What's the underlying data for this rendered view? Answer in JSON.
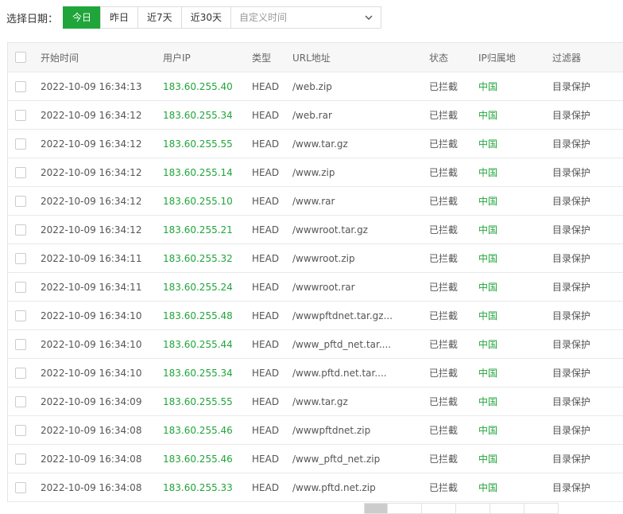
{
  "filter": {
    "label": "选择日期：",
    "ranges": [
      "今日",
      "昨日",
      "近7天",
      "近30天"
    ],
    "active_index": 0,
    "custom_placeholder": "自定义时间"
  },
  "table": {
    "headers": [
      "开始时间",
      "用户IP",
      "类型",
      "URL地址",
      "状态",
      "IP归属地",
      "过滤器"
    ],
    "rows": [
      {
        "time": "2022-10-09 16:34:13",
        "ip": "183.60.255.40",
        "type": "HEAD",
        "url": "/web.zip",
        "status": "已拦截",
        "loc": "中国",
        "filter": "目录保护"
      },
      {
        "time": "2022-10-09 16:34:12",
        "ip": "183.60.255.34",
        "type": "HEAD",
        "url": "/web.rar",
        "status": "已拦截",
        "loc": "中国",
        "filter": "目录保护"
      },
      {
        "time": "2022-10-09 16:34:12",
        "ip": "183.60.255.55",
        "type": "HEAD",
        "url": "/www.tar.gz",
        "status": "已拦截",
        "loc": "中国",
        "filter": "目录保护"
      },
      {
        "time": "2022-10-09 16:34:12",
        "ip": "183.60.255.14",
        "type": "HEAD",
        "url": "/www.zip",
        "status": "已拦截",
        "loc": "中国",
        "filter": "目录保护"
      },
      {
        "time": "2022-10-09 16:34:12",
        "ip": "183.60.255.10",
        "type": "HEAD",
        "url": "/www.rar",
        "status": "已拦截",
        "loc": "中国",
        "filter": "目录保护"
      },
      {
        "time": "2022-10-09 16:34:12",
        "ip": "183.60.255.21",
        "type": "HEAD",
        "url": "/wwwroot.tar.gz",
        "status": "已拦截",
        "loc": "中国",
        "filter": "目录保护"
      },
      {
        "time": "2022-10-09 16:34:11",
        "ip": "183.60.255.32",
        "type": "HEAD",
        "url": "/wwwroot.zip",
        "status": "已拦截",
        "loc": "中国",
        "filter": "目录保护"
      },
      {
        "time": "2022-10-09 16:34:11",
        "ip": "183.60.255.24",
        "type": "HEAD",
        "url": "/wwwroot.rar",
        "status": "已拦截",
        "loc": "中国",
        "filter": "目录保护"
      },
      {
        "time": "2022-10-09 16:34:10",
        "ip": "183.60.255.48",
        "type": "HEAD",
        "url": "/wwwpftdnet.tar.gz...",
        "status": "已拦截",
        "loc": "中国",
        "filter": "目录保护"
      },
      {
        "time": "2022-10-09 16:34:10",
        "ip": "183.60.255.44",
        "type": "HEAD",
        "url": "/www_pftd_net.tar....",
        "status": "已拦截",
        "loc": "中国",
        "filter": "目录保护"
      },
      {
        "time": "2022-10-09 16:34:10",
        "ip": "183.60.255.34",
        "type": "HEAD",
        "url": "/www.pftd.net.tar....",
        "status": "已拦截",
        "loc": "中国",
        "filter": "目录保护"
      },
      {
        "time": "2022-10-09 16:34:09",
        "ip": "183.60.255.55",
        "type": "HEAD",
        "url": "/www.tar.gz",
        "status": "已拦截",
        "loc": "中国",
        "filter": "目录保护"
      },
      {
        "time": "2022-10-09 16:34:08",
        "ip": "183.60.255.46",
        "type": "HEAD",
        "url": "/wwwpftdnet.zip",
        "status": "已拦截",
        "loc": "中国",
        "filter": "目录保护"
      },
      {
        "time": "2022-10-09 16:34:08",
        "ip": "183.60.255.46",
        "type": "HEAD",
        "url": "/www_pftd_net.zip",
        "status": "已拦截",
        "loc": "中国",
        "filter": "目录保护"
      },
      {
        "time": "2022-10-09 16:34:08",
        "ip": "183.60.255.33",
        "type": "HEAD",
        "url": "/www.pftd.net.zip",
        "status": "已拦截",
        "loc": "中国",
        "filter": "目录保护"
      }
    ]
  },
  "colors": {
    "accent": "#20a53a"
  },
  "icons": {
    "custom_time": "chevron-down-icon"
  }
}
